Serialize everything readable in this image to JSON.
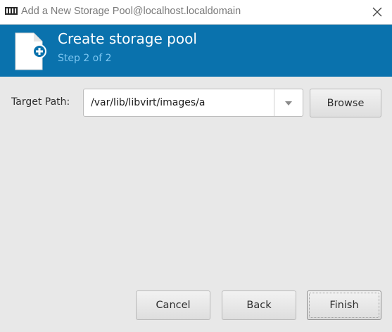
{
  "window": {
    "title": "Add a New Storage Pool@localhost.localdomain",
    "app_icon": "virt-manager-icon",
    "close_icon": "close-icon"
  },
  "banner": {
    "icon": "new-document-icon",
    "title": "Create storage pool",
    "step": "Step 2 of 2",
    "background_color": "#0a72ad",
    "step_color": "#7cc6f1"
  },
  "form": {
    "target_path_label": "Target Path:",
    "target_path_value": "/var/lib/libvirt/images/a",
    "dropdown_icon": "chevron-down-icon",
    "browse_label": "Browse"
  },
  "buttons": {
    "cancel_label": "Cancel",
    "back_label": "Back",
    "finish_label": "Finish"
  }
}
